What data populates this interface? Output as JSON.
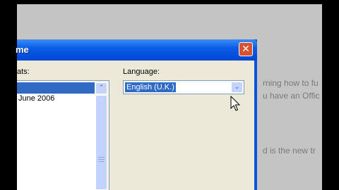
{
  "background_document": {
    "lines": [
      "rning how to fu",
      "u have an Offic",
      "d is the new tr"
    ]
  },
  "dialog": {
    "title": "me",
    "close_glyph": "✕",
    "formats_label": "ats:",
    "language_label": "Language:",
    "formats_list": {
      "items": [
        "June 2006"
      ]
    },
    "language_select": {
      "value": "English (U.K.)",
      "arrow_glyph": "⌄"
    },
    "scroll_up_glyph": "⌃"
  },
  "colors": {
    "titlebar": "#0a5ee8",
    "selection": "#316ac5",
    "close_button": "#d9522f",
    "dialog_face": "#ece9d8"
  },
  "icons": [
    "close-icon",
    "chevron-down-icon",
    "chevron-up-icon",
    "mouse-cursor-icon"
  ]
}
